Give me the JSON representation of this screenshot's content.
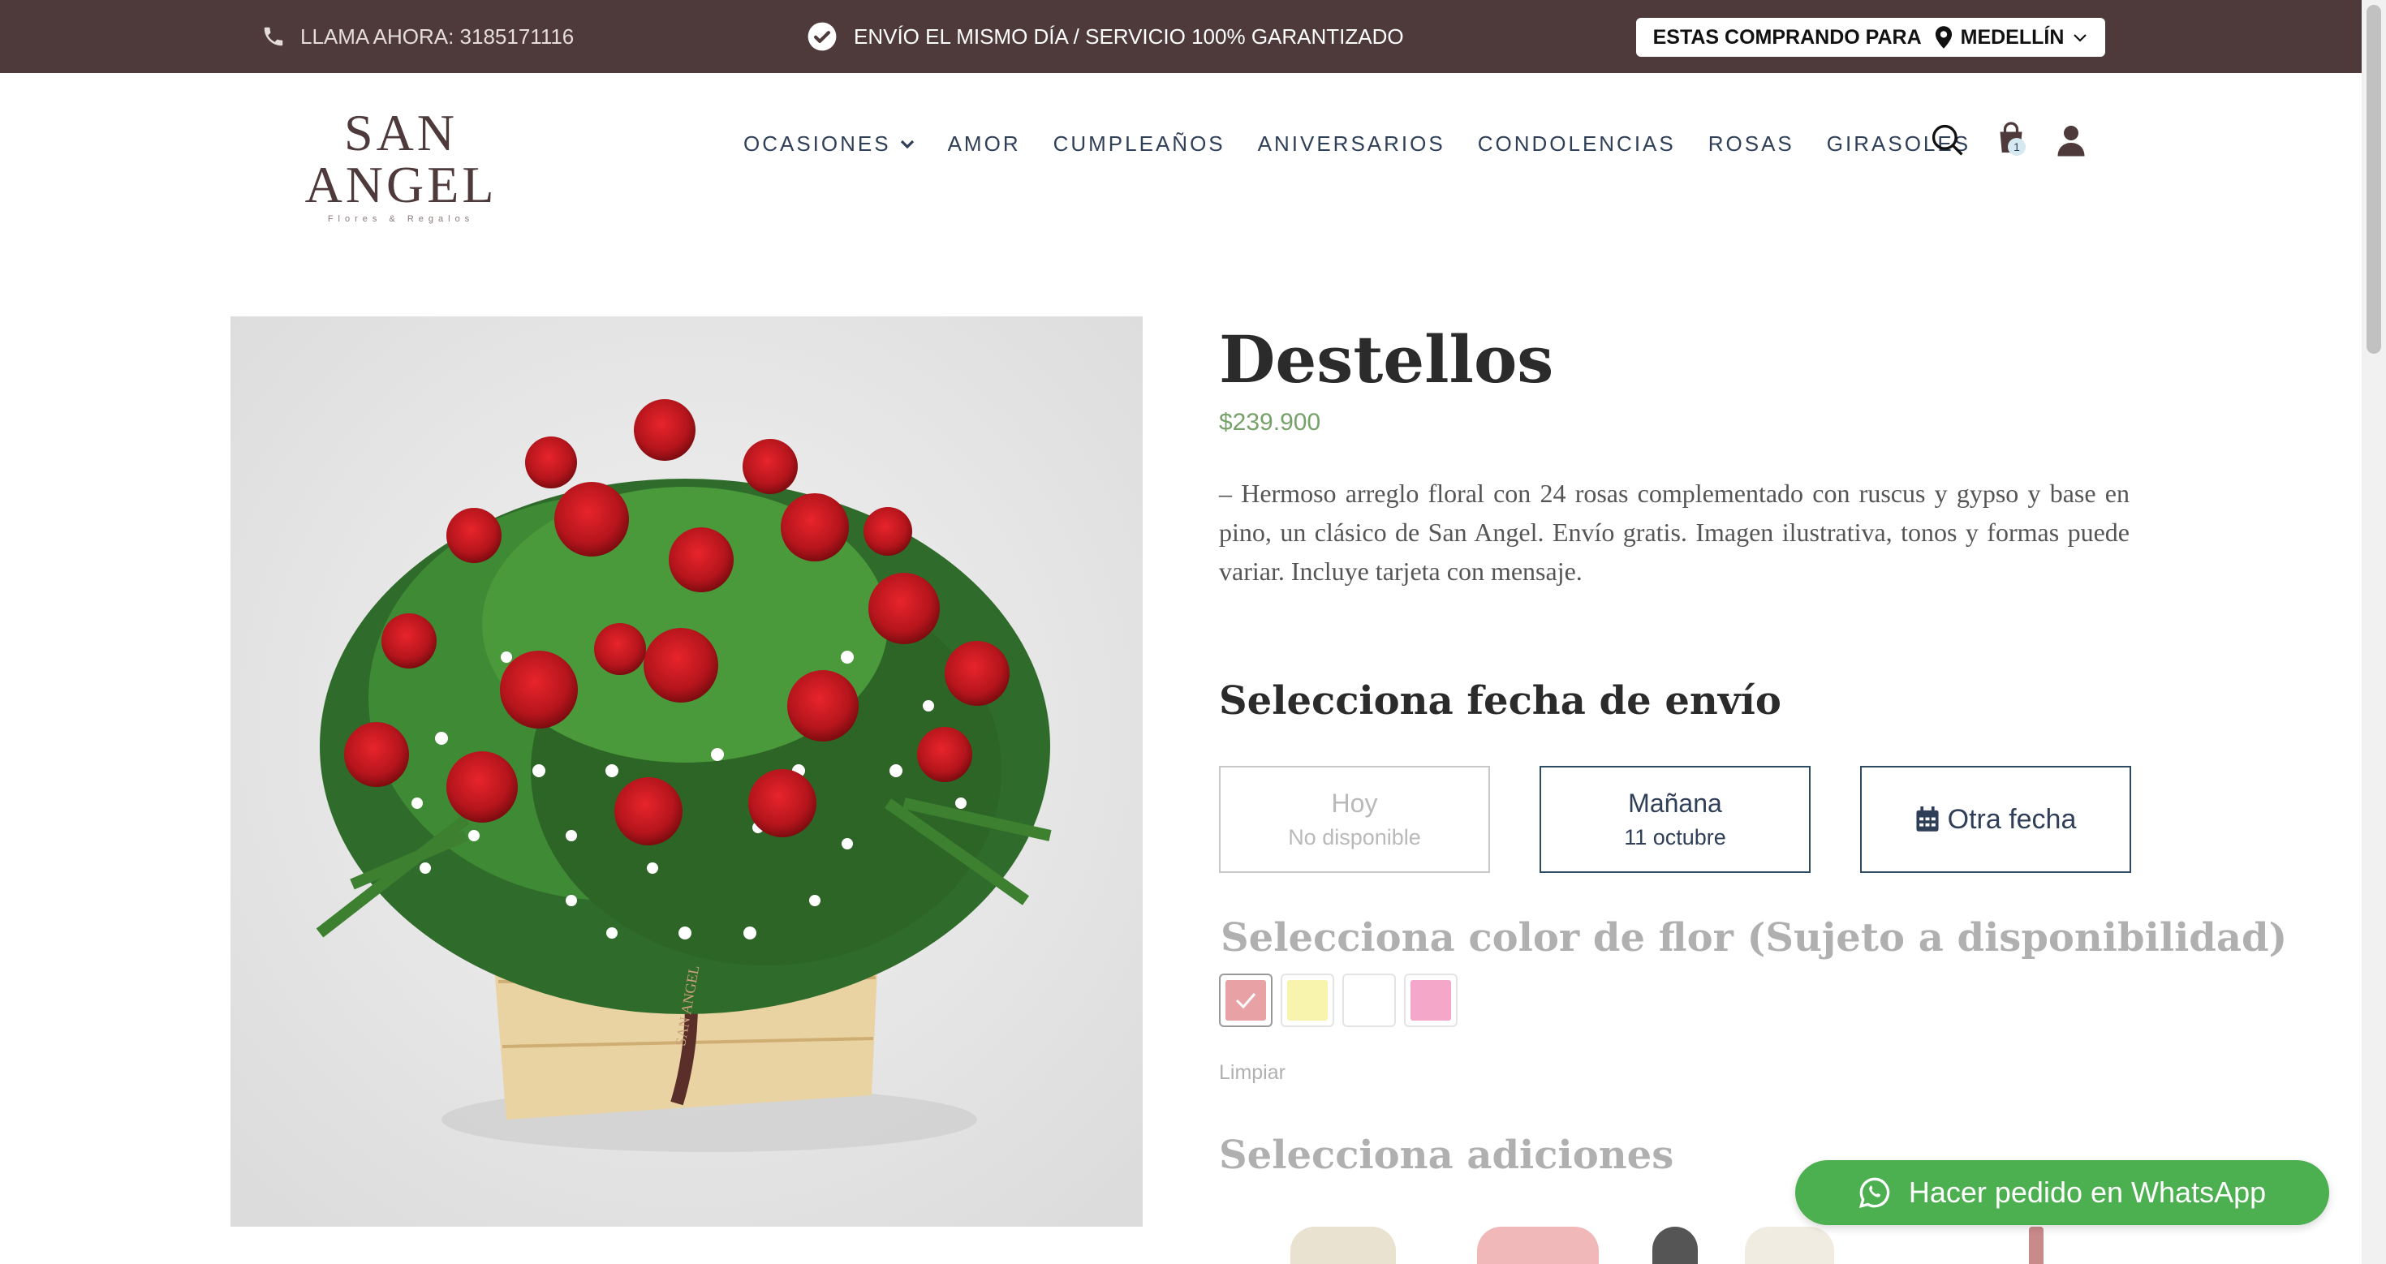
{
  "topbar": {
    "phone_label": "LLAMA AHORA: 3185171116",
    "shipping_label": "ENVÍO EL MISMO DÍA / SERVICIO 100% GARANTIZADO",
    "buying_for_label": "ESTAS COMPRANDO PARA",
    "city": "MEDELLÍN"
  },
  "header": {
    "logo_name": "SAN ANGEL",
    "logo_tagline": "Flores & Regalos",
    "nav": [
      {
        "label": "OCASIONES"
      },
      {
        "label": "AMOR"
      },
      {
        "label": "CUMPLEAÑOS"
      },
      {
        "label": "ANIVERSARIOS"
      },
      {
        "label": "CONDOLENCIAS"
      },
      {
        "label": "ROSAS"
      },
      {
        "label": "GIRASOLES"
      }
    ],
    "cart_count": "1"
  },
  "product": {
    "title": "Destellos",
    "price": "$239.900",
    "description": "– Hermoso arreglo floral con 24 rosas complementado con ruscus y gypso y base en pino, un clásico de San Angel. Envío gratis. Imagen ilustrativa, tonos y formas puede variar. Incluye tarjeta con mensaje.",
    "box_brand": "SAN ANGEL"
  },
  "delivery": {
    "heading": "Selecciona fecha de envío",
    "options": [
      {
        "line1": "Hoy",
        "line2": "No disponible"
      },
      {
        "line1": "Mañana",
        "line2": "11 octubre"
      },
      {
        "line1": "Otra fecha"
      }
    ]
  },
  "color": {
    "heading": "Selecciona color de flor (Sujeto a disponibilidad)",
    "swatches": [
      "#e8a2a6",
      "#f8f3ad",
      "#ffffff",
      "#f4a7c8"
    ],
    "selected": 0,
    "clear_label": "Limpiar"
  },
  "addons": {
    "heading": "Selecciona adiciones"
  },
  "whatsapp": {
    "label": "Hacer pedido en WhatsApp"
  }
}
